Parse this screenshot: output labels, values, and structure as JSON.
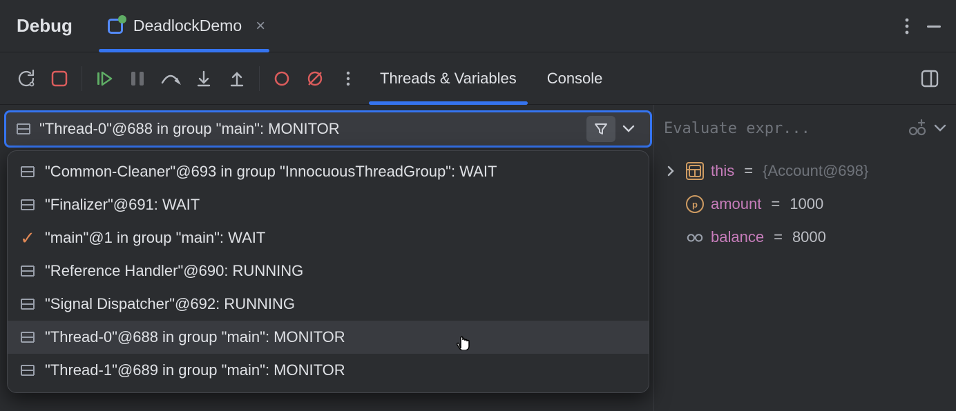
{
  "header": {
    "title": "Debug",
    "tab_label": "DeadlockDemo"
  },
  "toolbar": {
    "tabs": {
      "threads": "Threads & Variables",
      "console": "Console"
    }
  },
  "threads": {
    "selected": "\"Thread-0\"@688 in group \"main\": MONITOR",
    "items": [
      {
        "icon": "thread",
        "label": "\"Common-Cleaner\"@693 in group \"InnocuousThreadGroup\": WAIT"
      },
      {
        "icon": "thread",
        "label": "\"Finalizer\"@691: WAIT"
      },
      {
        "icon": "check",
        "label": "\"main\"@1 in group \"main\": WAIT"
      },
      {
        "icon": "thread",
        "label": "\"Reference Handler\"@690: RUNNING"
      },
      {
        "icon": "thread",
        "label": "\"Signal Dispatcher\"@692: RUNNING"
      },
      {
        "icon": "thread",
        "label": "\"Thread-0\"@688 in group \"main\": MONITOR",
        "hover": true
      },
      {
        "icon": "thread",
        "label": "\"Thread-1\"@689 in group \"main\": MONITOR"
      }
    ]
  },
  "evaluate_placeholder": "Evaluate expr...",
  "variables": [
    {
      "kind": "obj",
      "expandable": true,
      "name": "this",
      "eq": " = ",
      "value": "{Account@698}",
      "dim": true
    },
    {
      "kind": "p",
      "expandable": false,
      "name": "amount",
      "eq": " = ",
      "value": "1000"
    },
    {
      "kind": "glasses",
      "expandable": false,
      "name": "balance",
      "eq": " = ",
      "value": "8000"
    }
  ]
}
